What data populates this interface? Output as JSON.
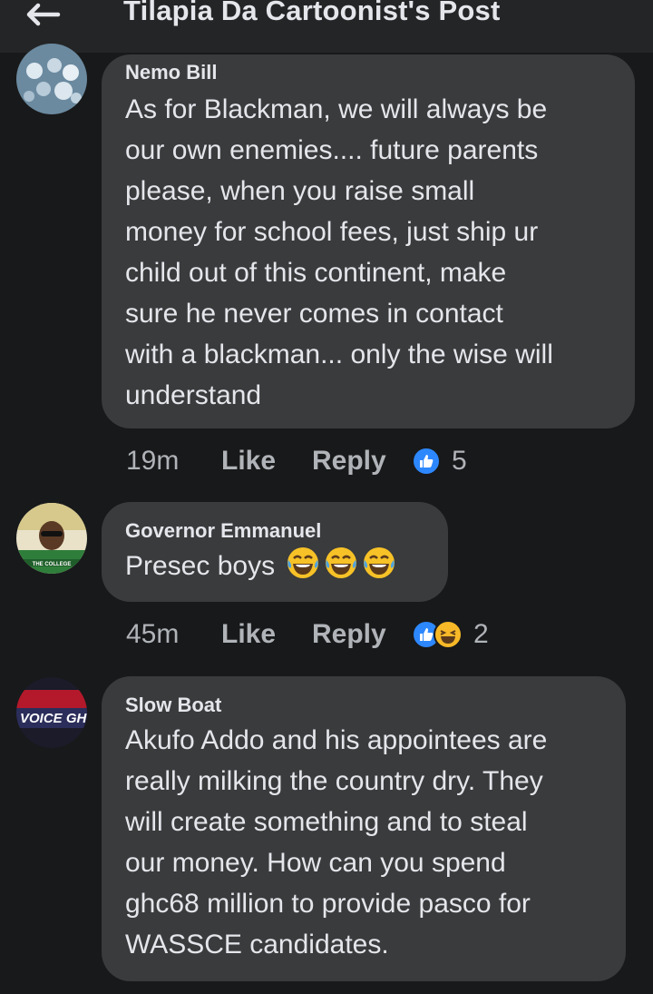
{
  "header": {
    "title": "Tilapia Da Cartoonist's Post"
  },
  "comments": [
    {
      "author": "Nemo Bill",
      "lines": [
        "As for Blackman, we will always be",
        "our own enemies.... future parents",
        "please, when you raise small",
        "money for school fees, just ship ur",
        "child out of this continent, make",
        "sure he never comes in contact",
        "with a blackman... only the wise will",
        "understand"
      ],
      "time": "19m",
      "like_label": "Like",
      "reply_label": "Reply",
      "reaction_count": "5",
      "reactions": [
        "like"
      ]
    },
    {
      "author": "Governor Emmanuel",
      "text": "Presec boys",
      "emojis": [
        "tears-of-joy",
        "tears-of-joy",
        "tears-of-joy"
      ],
      "avatar_caption": "THE COLLEGE",
      "time": "45m",
      "like_label": "Like",
      "reply_label": "Reply",
      "reaction_count": "2",
      "reactions": [
        "like",
        "haha"
      ]
    },
    {
      "author": "Slow Boat",
      "avatar_caption": "VOICE GHA",
      "lines": [
        "Akufo Addo and his appointees are",
        "really milking the country dry. They",
        "will create something and to steal",
        "our money. How can you spend",
        "ghc68 million to provide pasco for",
        "WASSCE candidates."
      ]
    }
  ],
  "colors": {
    "background": "#18191a",
    "bubble": "#3a3b3c",
    "like_blue": "#2d88ff",
    "haha_yellow": "#f7b928",
    "secondary_text": "#b0b3b8"
  }
}
